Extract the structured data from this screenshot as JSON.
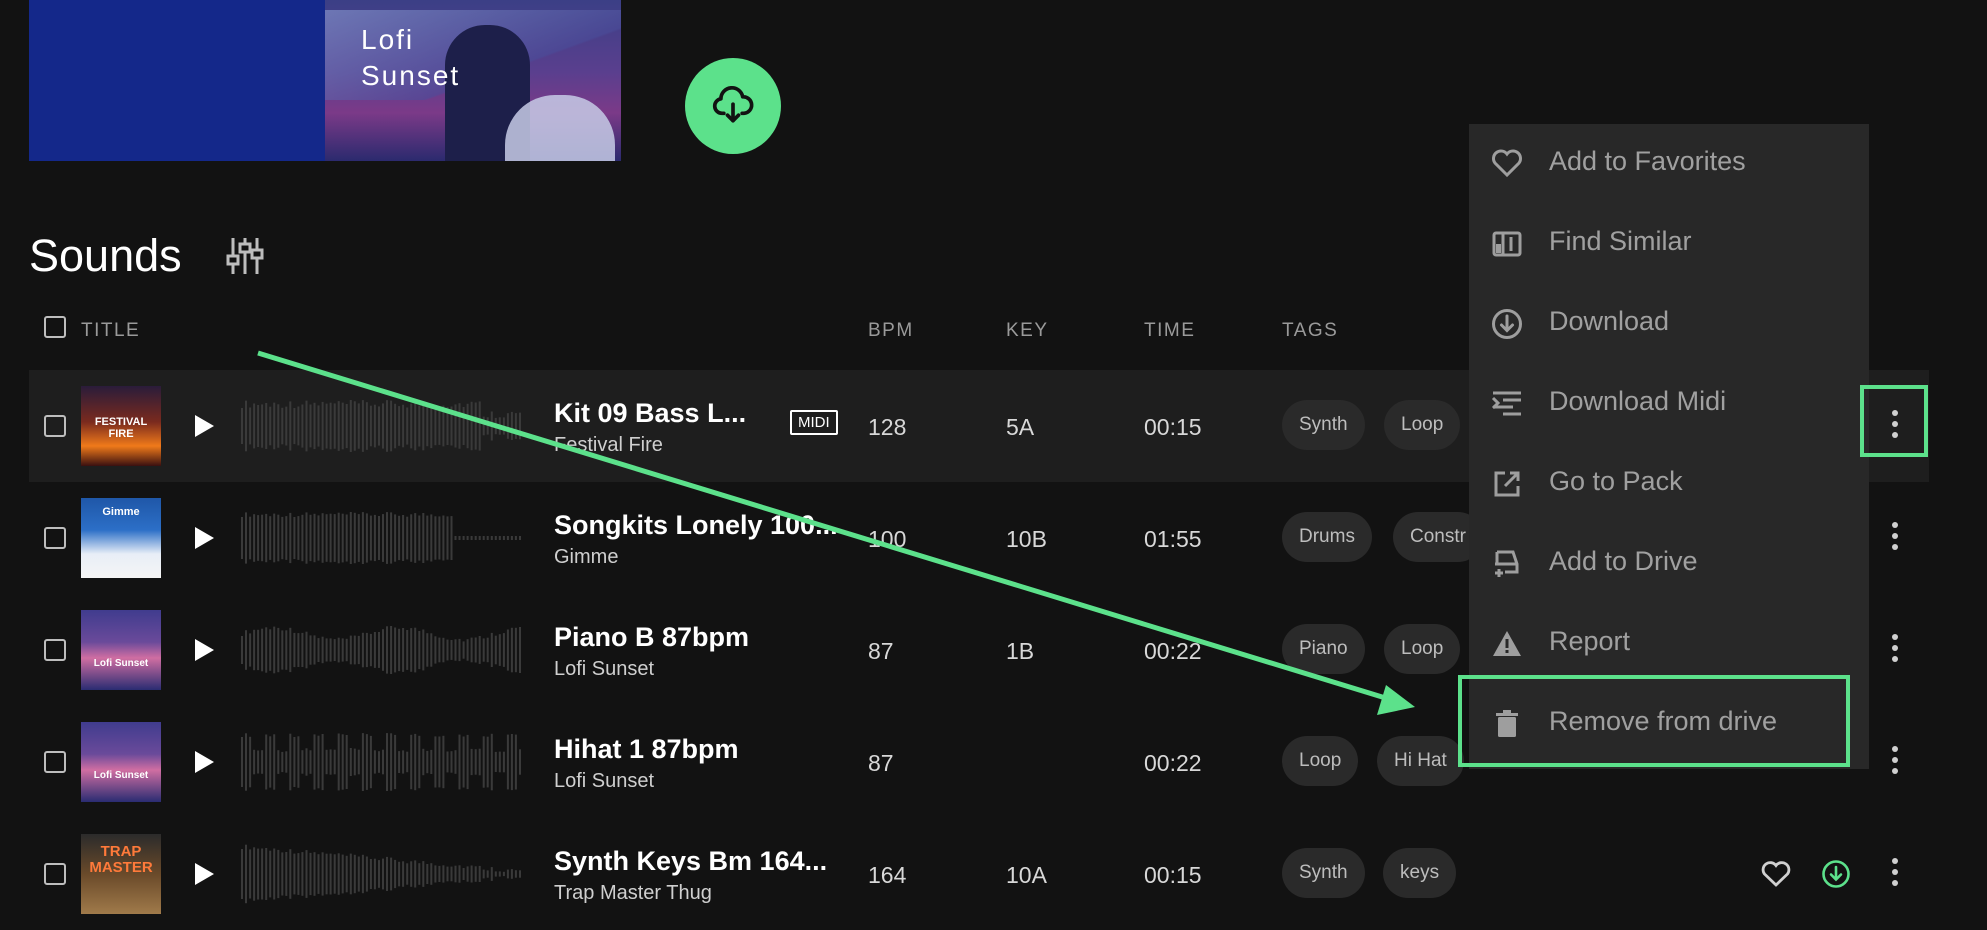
{
  "hero": {
    "art_title_line1": "Lofi",
    "art_title_line2": "Sunset"
  },
  "section": {
    "title": "Sounds"
  },
  "table": {
    "headers": {
      "title": "TITLE",
      "bpm": "BPM",
      "key": "KEY",
      "time": "TIME",
      "tags": "TAGS"
    },
    "rows": [
      {
        "name": "Kit 09 Bass L...",
        "pack": "Festival Fire",
        "midi": "MIDI",
        "bpm": "128",
        "key": "5A",
        "time": "00:15",
        "tags": [
          "Synth",
          "Loop"
        ],
        "art": "FESTIVAL FIRE"
      },
      {
        "name": "Songkits Lonely 100...",
        "pack": "Gimme",
        "bpm": "100",
        "key": "10B",
        "time": "01:55",
        "tags": [
          "Drums",
          "Constr"
        ],
        "art": "Gimme"
      },
      {
        "name": "Piano B 87bpm",
        "pack": "Lofi Sunset",
        "bpm": "87",
        "key": "1B",
        "time": "00:22",
        "tags": [
          "Piano",
          "Loop"
        ],
        "art": "Lofi Sunset"
      },
      {
        "name": "Hihat 1 87bpm",
        "pack": "Lofi Sunset",
        "bpm": "87",
        "key": "",
        "time": "00:22",
        "tags": [
          "Loop",
          "Hi Hat"
        ],
        "art": "Lofi Sunset"
      },
      {
        "name": "Synth Keys Bm 164...",
        "pack": "Trap Master Thug",
        "bpm": "164",
        "key": "10A",
        "time": "00:15",
        "tags": [
          "Synth",
          "keys"
        ],
        "art": "TRAP MASTER"
      }
    ]
  },
  "context_menu": {
    "items": [
      {
        "label": "Add to Favorites",
        "icon": "heart-icon"
      },
      {
        "label": "Find Similar",
        "icon": "find-similar-icon"
      },
      {
        "label": "Download",
        "icon": "download-icon"
      },
      {
        "label": "Download Midi",
        "icon": "midi-icon"
      },
      {
        "label": "Go to Pack",
        "icon": "external-link-icon"
      },
      {
        "label": "Add to Drive",
        "icon": "drive-add-icon"
      },
      {
        "label": "Report",
        "icon": "warning-icon"
      },
      {
        "label": "Remove from drive",
        "icon": "trash-icon"
      }
    ]
  },
  "colors": {
    "accent": "#5ce18b",
    "background": "#121212",
    "menu": "#282828",
    "tag": "#2a2a2a"
  }
}
